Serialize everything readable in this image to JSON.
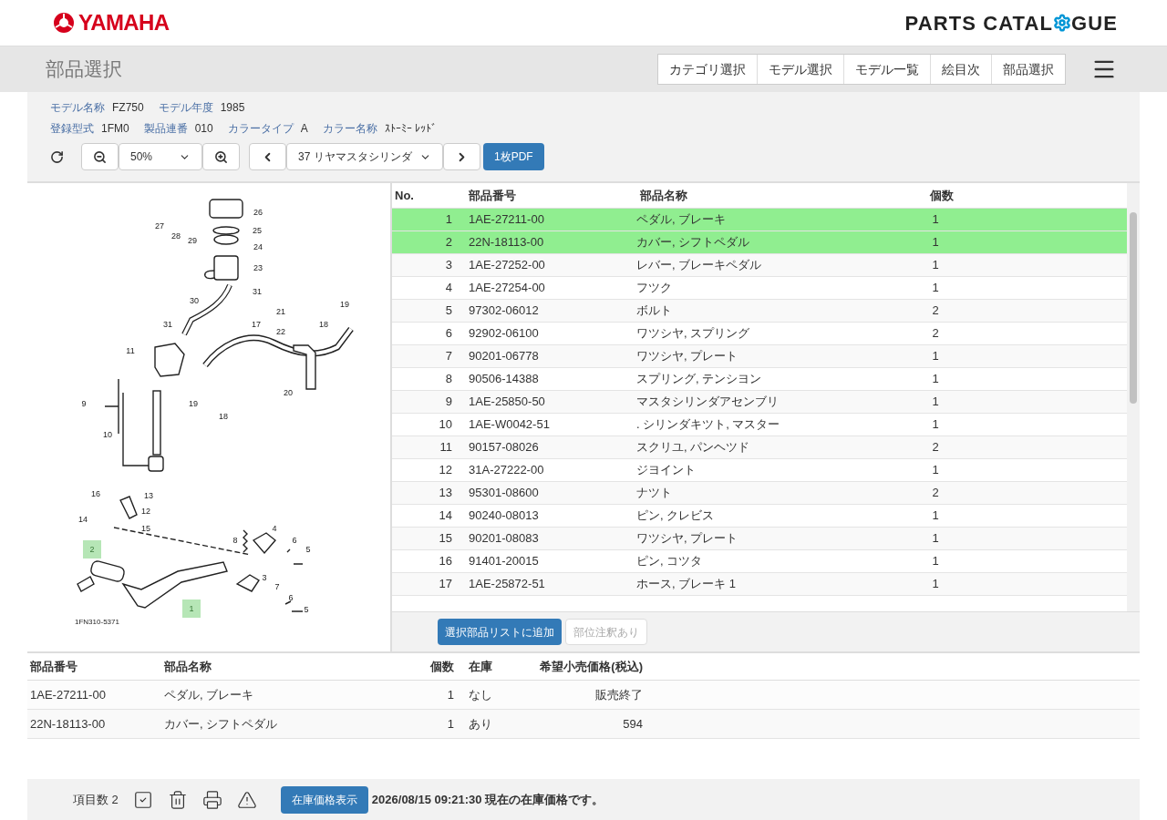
{
  "header": {
    "logo_text": "YAMAHA",
    "catalogue_text_start": "PARTS CATAL",
    "catalogue_text_end": "GUE"
  },
  "title": "部品選択",
  "nav": [
    "カテゴリ選択",
    "モデル選択",
    "モデル一覧",
    "絵目次",
    "部品選択"
  ],
  "info_rows": [
    [
      {
        "label": "モデル名称",
        "value": "FZ750"
      },
      {
        "label": "モデル年度",
        "value": "1985"
      }
    ],
    [
      {
        "label": "登録型式",
        "value": "1FM0"
      },
      {
        "label": "製品連番",
        "value": "010"
      },
      {
        "label": "カラータイプ",
        "value": "A"
      },
      {
        "label": "カラー名称",
        "value": "ｽﾄｰﾐｰ ﾚｯﾄﾞ"
      }
    ]
  ],
  "toolbar": {
    "zoom": "50%",
    "figure": "37 リヤマスタシリンダ",
    "pdf_button": "1枚PDF"
  },
  "diagram": {
    "code": "1FN310-5371",
    "callouts": [
      {
        "label": "26",
        "selected": false
      },
      {
        "label": "27",
        "selected": false
      },
      {
        "label": "25",
        "selected": false
      },
      {
        "label": "28",
        "selected": false
      },
      {
        "label": "29",
        "selected": false
      },
      {
        "label": "24",
        "selected": false
      },
      {
        "label": "23",
        "selected": false
      },
      {
        "label": "31",
        "selected": false
      },
      {
        "label": "30",
        "selected": false
      },
      {
        "label": "19",
        "selected": false
      },
      {
        "label": "21",
        "selected": false
      },
      {
        "label": "31",
        "selected": false
      },
      {
        "label": "17",
        "selected": false
      },
      {
        "label": "18",
        "selected": false
      },
      {
        "label": "22",
        "selected": false
      },
      {
        "label": "11",
        "selected": false
      },
      {
        "label": "20",
        "selected": false
      },
      {
        "label": "9",
        "selected": false
      },
      {
        "label": "19",
        "selected": false
      },
      {
        "label": "18",
        "selected": false
      },
      {
        "label": "10",
        "selected": false
      },
      {
        "label": "16",
        "selected": false
      },
      {
        "label": "13",
        "selected": false
      },
      {
        "label": "12",
        "selected": false
      },
      {
        "label": "14",
        "selected": false
      },
      {
        "label": "15",
        "selected": false
      },
      {
        "label": "4",
        "selected": false
      },
      {
        "label": "8",
        "selected": false
      },
      {
        "label": "6",
        "selected": false
      },
      {
        "label": "2",
        "selected": true
      },
      {
        "label": "5",
        "selected": false
      },
      {
        "label": "3",
        "selected": false
      },
      {
        "label": "7",
        "selected": false
      },
      {
        "label": "6",
        "selected": false
      },
      {
        "label": "1",
        "selected": true
      },
      {
        "label": "5",
        "selected": false
      }
    ]
  },
  "parts_table": {
    "columns": [
      "No.",
      "部品番号",
      "部品名称",
      "個数"
    ],
    "rows": [
      {
        "no": "1",
        "part_number": "1AE-27211-00",
        "name": "ペダル, ブレーキ",
        "qty": "1",
        "selected": true
      },
      {
        "no": "2",
        "part_number": "22N-18113-00",
        "name": "カバー, シフトペダル",
        "qty": "1",
        "selected": true
      },
      {
        "no": "3",
        "part_number": "1AE-27252-00",
        "name": "レバー, ブレーキペダル",
        "qty": "1",
        "selected": false
      },
      {
        "no": "4",
        "part_number": "1AE-27254-00",
        "name": "フツク",
        "qty": "1",
        "selected": false
      },
      {
        "no": "5",
        "part_number": "97302-06012",
        "name": "ボルト",
        "qty": "2",
        "selected": false
      },
      {
        "no": "6",
        "part_number": "92902-06100",
        "name": "ワツシヤ, スプリング",
        "qty": "2",
        "selected": false
      },
      {
        "no": "7",
        "part_number": "90201-06778",
        "name": "ワツシヤ, プレート",
        "qty": "1",
        "selected": false
      },
      {
        "no": "8",
        "part_number": "90506-14388",
        "name": "スプリング, テンシヨン",
        "qty": "1",
        "selected": false
      },
      {
        "no": "9",
        "part_number": "1AE-25850-50",
        "name": "マスタシリンダアセンブリ",
        "qty": "1",
        "selected": false
      },
      {
        "no": "10",
        "part_number": "1AE-W0042-51",
        "name": ". シリンダキツト, マスター",
        "qty": "1",
        "selected": false
      },
      {
        "no": "11",
        "part_number": "90157-08026",
        "name": "スクリユ, パンヘツド",
        "qty": "2",
        "selected": false
      },
      {
        "no": "12",
        "part_number": "31A-27222-00",
        "name": "ジヨイント",
        "qty": "1",
        "selected": false
      },
      {
        "no": "13",
        "part_number": "95301-08600",
        "name": "ナツト",
        "qty": "2",
        "selected": false
      },
      {
        "no": "14",
        "part_number": "90240-08013",
        "name": "ピン, クレビス",
        "qty": "1",
        "selected": false
      },
      {
        "no": "15",
        "part_number": "90201-08083",
        "name": "ワツシヤ, プレート",
        "qty": "1",
        "selected": false
      },
      {
        "no": "16",
        "part_number": "91401-20015",
        "name": "ピン, コツタ",
        "qty": "1",
        "selected": false
      },
      {
        "no": "17",
        "part_number": "1AE-25872-51",
        "name": "ホース, ブレーキ 1",
        "qty": "1",
        "selected": false
      }
    ]
  },
  "actions": [
    {
      "label": "選択部品リストに追加",
      "disabled": false
    },
    {
      "label": "部位注釈あり",
      "disabled": true
    }
  ],
  "selected_list": {
    "columns": [
      "部品番号",
      "部品名称",
      "個数",
      "在庫",
      "希望小売価格(税込)"
    ],
    "rows": [
      {
        "part_number": "1AE-27211-00",
        "name": "ペダル, ブレーキ",
        "qty": "1",
        "stock": "なし",
        "price": "販売終了"
      },
      {
        "part_number": "22N-18113-00",
        "name": "カバー, シフトペダル",
        "qty": "1",
        "stock": "あり",
        "price": "594"
      }
    ]
  },
  "footer": {
    "count": "項目数 2",
    "price_button": "在庫価格表示",
    "message": "2026/08/15 09:21:30 現在の在庫価格です。"
  }
}
